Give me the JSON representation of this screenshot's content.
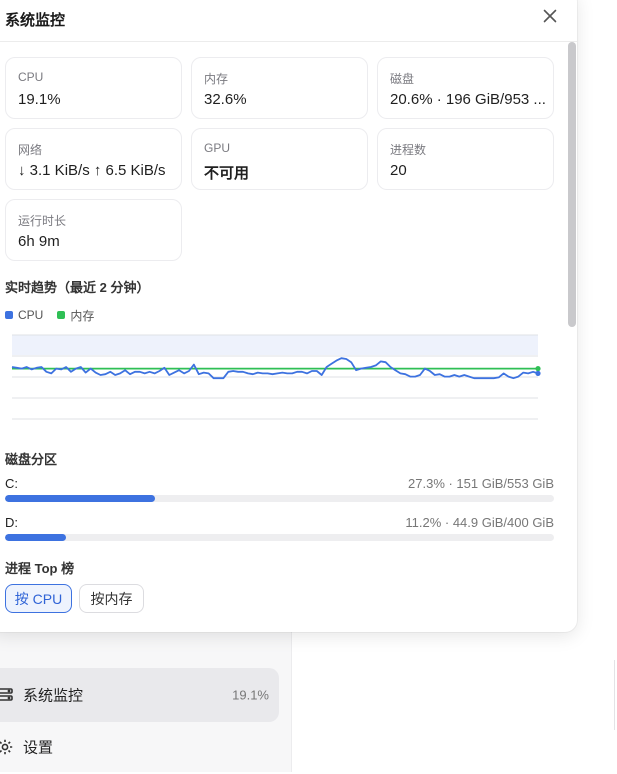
{
  "panel": {
    "title": "系统监控",
    "close_icon": "close-icon"
  },
  "stats": [
    {
      "label": "CPU",
      "value": "19.1%"
    },
    {
      "label": "内存",
      "value": "32.6%"
    },
    {
      "label": "磁盘",
      "value": "20.6% · 196 GiB/953 ..."
    },
    {
      "label": "网络",
      "value": "↓ 3.1 KiB/s ↑ 6.5 KiB/s"
    },
    {
      "label": "GPU",
      "value": "不可用"
    },
    {
      "label": "进程数",
      "value": "20"
    },
    {
      "label": "运行时长",
      "value": "6h 9m"
    }
  ],
  "trend": {
    "title": "实时趋势（最近 2 分钟）",
    "legend": [
      {
        "name": "CPU",
        "color": "#3d72e0"
      },
      {
        "name": "内存",
        "color": "#2fbf55"
      }
    ]
  },
  "chart_data": {
    "type": "line",
    "ylim": [
      0,
      100
    ],
    "grid": true,
    "series": [
      {
        "name": "CPU",
        "color": "#3d72e0",
        "values": [
          20,
          19.5,
          19,
          20,
          18.5,
          19.5,
          20,
          17,
          16,
          19,
          18.5,
          20,
          17,
          19,
          20,
          16.5,
          19,
          16.5,
          15,
          15.5,
          17,
          15,
          16,
          18,
          15.5,
          17,
          17,
          16,
          17,
          16,
          17.5,
          19.5,
          15,
          16.5,
          18,
          16,
          17.5,
          21.5,
          15.5,
          16.5,
          16,
          13,
          13,
          13,
          17,
          17.5,
          17,
          17,
          16,
          15.5,
          16.5,
          16,
          16,
          15.5,
          16,
          16.5,
          16,
          16,
          17,
          17,
          16,
          17.5,
          17.5,
          15,
          20,
          22,
          24,
          25.5,
          25,
          23,
          18,
          19,
          19.5,
          20,
          21,
          23.5,
          23,
          20,
          18,
          16,
          15.5,
          14,
          14,
          15,
          19,
          17.5,
          15,
          15.5,
          14,
          14,
          15,
          14,
          15,
          14,
          13,
          13,
          13,
          13,
          13,
          13.5,
          16,
          14,
          13,
          14,
          16.5,
          16,
          17,
          16
        ]
      },
      {
        "name": "内存",
        "color": "#2fbf55",
        "values": [
          19,
          19,
          19,
          19,
          19,
          19,
          19,
          19,
          19,
          19,
          19,
          19,
          19,
          19,
          19,
          19,
          19,
          19,
          19,
          19,
          19,
          19,
          19,
          19,
          19,
          19,
          19,
          19,
          19,
          19,
          19,
          19,
          19,
          19,
          19,
          19,
          19,
          19,
          19,
          19,
          19,
          19,
          19,
          19,
          19,
          19,
          19,
          19,
          19,
          19,
          19,
          19,
          19,
          19,
          19,
          19,
          19,
          19,
          19,
          19,
          19,
          19,
          19,
          19,
          19,
          19,
          19,
          19,
          19,
          19,
          19,
          19,
          19,
          19,
          19,
          19,
          19,
          19,
          19,
          19,
          19,
          19,
          19,
          19,
          19,
          19,
          19,
          19,
          19,
          19,
          19,
          19,
          19,
          19,
          19,
          19,
          19,
          19,
          19,
          19,
          19,
          19,
          19,
          19,
          19,
          19
        ]
      }
    ]
  },
  "disks": {
    "title": "磁盘分区",
    "items": [
      {
        "name": "C:",
        "info": "27.3% · 151 GiB/553 GiB",
        "fraction": 0.273
      },
      {
        "name": "D:",
        "info": "11.2% · 44.9 GiB/400 GiB",
        "fraction": 0.112
      }
    ]
  },
  "top": {
    "title": "进程 Top 榜",
    "by_cpu": "按 CPU",
    "by_mem": "按内存"
  },
  "sidebar": {
    "monitor_label": "系统监控",
    "monitor_value": "19.1%",
    "monitor_icon": "monitor-icon",
    "settings_label": "设置",
    "settings_icon": "gear-icon"
  }
}
